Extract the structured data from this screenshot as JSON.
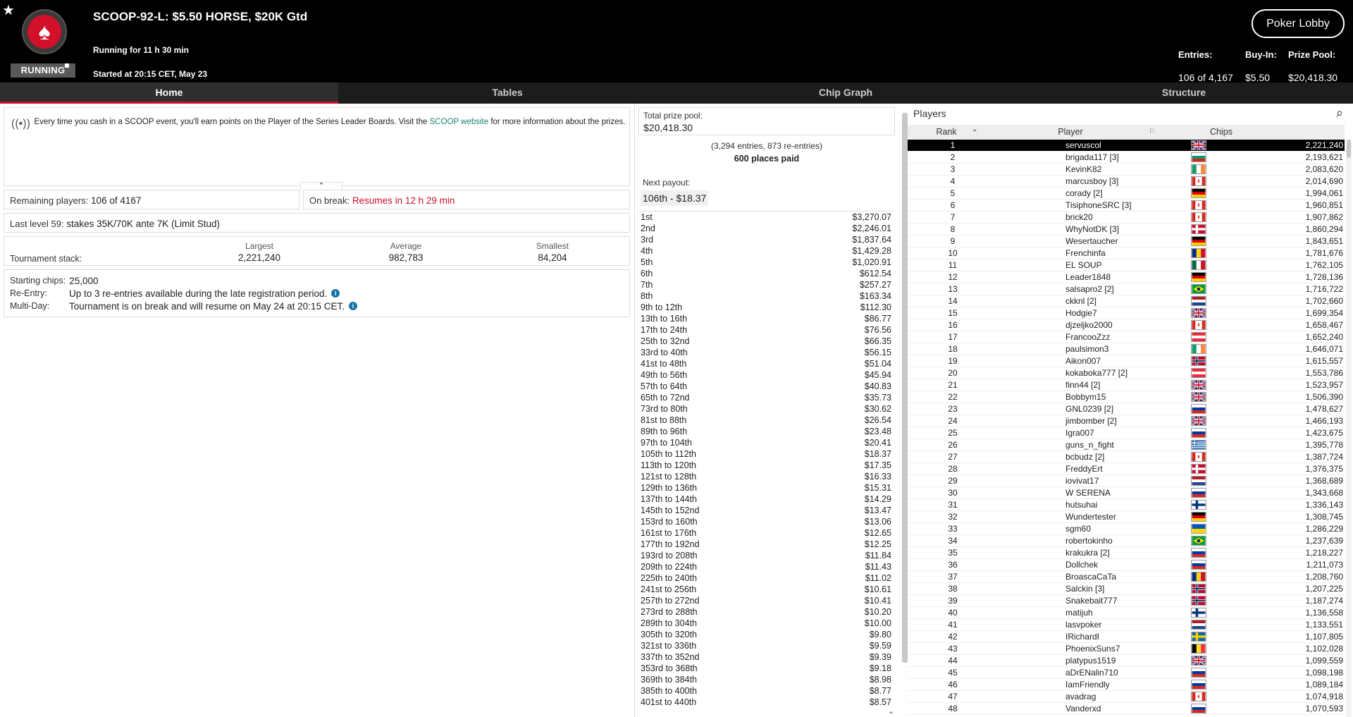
{
  "header": {
    "title": "SCOOP-92-L: $5.50 HORSE, $20K Gtd",
    "status": "RUNNING",
    "running_for": "Running for 11 h 30 min",
    "started_at": "Started at 20:15 CET, May 23",
    "lobby_button": "Poker Lobby",
    "entries_label": "Entries:",
    "entries_value": "106 of 4,167",
    "buyin_label": "Buy-In:",
    "buyin_value": "$5.50",
    "prize_label": "Prize Pool:",
    "prize_value": "$20,418.30"
  },
  "tabs": [
    {
      "label": "Home",
      "active": true
    },
    {
      "label": "Tables",
      "active": false
    },
    {
      "label": "Chip Graph",
      "active": false
    },
    {
      "label": "Structure",
      "active": false
    }
  ],
  "home": {
    "info_pre": "Every time you cash in a SCOOP event, you'll earn points on the Player of the Series Leader Boards. Visit the ",
    "info_link": "SCOOP website",
    "info_post": " for more information about the prizes.",
    "remaining_label": "Remaining players:",
    "remaining_value": "106 of 4167",
    "onbreak_label": "On break:",
    "onbreak_value": "Resumes in 12 h 29 min",
    "lastlevel_label": "Last level 59:",
    "lastlevel_value": "stakes 35K/70K ante 7K (Limit Stud)",
    "stack_label": "Tournament stack:",
    "largest_label": "Largest",
    "largest_value": "2,221,240",
    "average_label": "Average",
    "average_value": "982,783",
    "smallest_label": "Smallest",
    "smallest_value": "84,204",
    "starting_label": "Starting chips:",
    "starting_value": "25,000",
    "reentry_label": "Re-Entry:",
    "reentry_value": "Up to 3 re-entries available during the late registration period.",
    "multiday_label": "Multi-Day:",
    "multiday_value": "Tournament is on break and will resume on May 24 at 20:15 CET."
  },
  "prizes": {
    "pool_label": "Total prize pool:",
    "pool_value": "$20,418.30",
    "entries_text": "(3,294 entries, 873 re-entries)",
    "places_paid": "600 places paid",
    "next_label": "Next payout:",
    "next_value": "106th - $18.37",
    "rows": [
      [
        "1st",
        "$3,270.07"
      ],
      [
        "2nd",
        "$2,246.01"
      ],
      [
        "3rd",
        "$1,837.64"
      ],
      [
        "4th",
        "$1,429.28"
      ],
      [
        "5th",
        "$1,020.91"
      ],
      [
        "6th",
        "$612.54"
      ],
      [
        "7th",
        "$257.27"
      ],
      [
        "8th",
        "$163.34"
      ],
      [
        "9th to 12th",
        "$112.30"
      ],
      [
        "13th to 16th",
        "$86.77"
      ],
      [
        "17th to 24th",
        "$76.56"
      ],
      [
        "25th to 32nd",
        "$66.35"
      ],
      [
        "33rd to 40th",
        "$56.15"
      ],
      [
        "41st to 48th",
        "$51.04"
      ],
      [
        "49th to 56th",
        "$45.94"
      ],
      [
        "57th to 64th",
        "$40.83"
      ],
      [
        "65th to 72nd",
        "$35.73"
      ],
      [
        "73rd to 80th",
        "$30.62"
      ],
      [
        "81st to 88th",
        "$26.54"
      ],
      [
        "89th to 96th",
        "$23.48"
      ],
      [
        "97th to 104th",
        "$20.41"
      ],
      [
        "105th to 112th",
        "$18.37"
      ],
      [
        "113th to 120th",
        "$17.35"
      ],
      [
        "121st to 128th",
        "$16.33"
      ],
      [
        "129th to 136th",
        "$15.31"
      ],
      [
        "137th to 144th",
        "$14.29"
      ],
      [
        "145th to 152nd",
        "$13.47"
      ],
      [
        "153rd to 160th",
        "$13.06"
      ],
      [
        "161st to 176th",
        "$12.65"
      ],
      [
        "177th to 192nd",
        "$12.25"
      ],
      [
        "193rd to 208th",
        "$11.84"
      ],
      [
        "209th to 224th",
        "$11.43"
      ],
      [
        "225th to 240th",
        "$11.02"
      ],
      [
        "241st to 256th",
        "$10.61"
      ],
      [
        "257th to 272nd",
        "$10.41"
      ],
      [
        "273rd to 288th",
        "$10.20"
      ],
      [
        "289th to 304th",
        "$10.00"
      ],
      [
        "305th to 320th",
        "$9.80"
      ],
      [
        "321st to 336th",
        "$9.59"
      ],
      [
        "337th to 352nd",
        "$9.39"
      ],
      [
        "353rd to 368th",
        "$9.18"
      ],
      [
        "369th to 384th",
        "$8.98"
      ],
      [
        "385th to 400th",
        "$8.77"
      ],
      [
        "401st to 440th",
        "$8.57"
      ]
    ]
  },
  "players": {
    "title": "Players",
    "col_rank": "Rank",
    "col_player": "Player",
    "col_chips": "Chips",
    "rows": [
      [
        1,
        "servuscol",
        "gb",
        "2,221,240"
      ],
      [
        2,
        "brigada117 [3]",
        "bg",
        "2,193,621"
      ],
      [
        3,
        "KevinK82",
        "ie",
        "2,083,620"
      ],
      [
        4,
        "marcusboy [3]",
        "ca",
        "2,014,690"
      ],
      [
        5,
        "corady [2]",
        "de",
        "1,994,061"
      ],
      [
        6,
        "TisiphoneSRC [3]",
        "ca",
        "1,960,851"
      ],
      [
        7,
        "brick20",
        "ca",
        "1,907,862"
      ],
      [
        8,
        "WhyNotDK [3]",
        "dk",
        "1,860,294"
      ],
      [
        9,
        "Wesertaucher",
        "de",
        "1,843,651"
      ],
      [
        10,
        "Frenchinfa",
        "ro",
        "1,781,676"
      ],
      [
        11,
        "EL SOUP",
        "mx",
        "1,762,105"
      ],
      [
        12,
        "Leader1848",
        "de",
        "1,728,136"
      ],
      [
        13,
        "salsapro2 [2]",
        "br",
        "1,716,722"
      ],
      [
        14,
        "ckknl [2]",
        "nl",
        "1,702,660"
      ],
      [
        15,
        "Hodgie7",
        "gb",
        "1,699,354"
      ],
      [
        16,
        "djzeljko2000",
        "ca",
        "1,658,467"
      ],
      [
        17,
        "FrancooZzz",
        "at",
        "1,652,240"
      ],
      [
        18,
        "paulsimon3",
        "ie",
        "1,646,071"
      ],
      [
        19,
        "Aikon007",
        "no",
        "1,615,557"
      ],
      [
        20,
        "kokaboka777 [2]",
        "at",
        "1,553,786"
      ],
      [
        21,
        "finn44 [2]",
        "gb",
        "1,523,957"
      ],
      [
        22,
        "Bobbym15",
        "gb",
        "1,506,390"
      ],
      [
        23,
        "GNL0239 [2]",
        "ru",
        "1,478,627"
      ],
      [
        24,
        "jimbomber [2]",
        "gb",
        "1,466,193"
      ],
      [
        25,
        "Igra007",
        "ru",
        "1,423,675"
      ],
      [
        26,
        "guns_n_fight",
        "gr",
        "1,395,778"
      ],
      [
        27,
        "bcbudz [2]",
        "ca",
        "1,387,724"
      ],
      [
        28,
        "FreddyErt",
        "dk",
        "1,376,375"
      ],
      [
        29,
        "iovivat17",
        "nl",
        "1,368,689"
      ],
      [
        30,
        "W SERENA",
        "ru",
        "1,343,668"
      ],
      [
        31,
        "hutsuhai",
        "fi",
        "1,336,143"
      ],
      [
        32,
        "Wundertester",
        "de",
        "1,308,745"
      ],
      [
        33,
        "sgm60",
        "ua",
        "1,286,229"
      ],
      [
        34,
        "robertokinho",
        "br",
        "1,237,639"
      ],
      [
        35,
        "krakukra [2]",
        "ru",
        "1,218,227"
      ],
      [
        36,
        "Dollchek",
        "ru",
        "1,211,073"
      ],
      [
        37,
        "BroascaCaTa",
        "ro",
        "1,208,760"
      ],
      [
        38,
        "Salckin [3]",
        "no",
        "1,207,225"
      ],
      [
        39,
        "Snakebait777",
        "no",
        "1,187,274"
      ],
      [
        40,
        "matijuh",
        "fi",
        "1,136,558"
      ],
      [
        41,
        "lasvpoker",
        "nl",
        "1,133,551"
      ],
      [
        42,
        "IRichardI",
        "se",
        "1,107,805"
      ],
      [
        43,
        "PhoenixSuns7",
        "be",
        "1,102,028"
      ],
      [
        44,
        "platypus1519",
        "gb",
        "1,099,559"
      ],
      [
        45,
        "aDrENalin710",
        "ru",
        "1,098,198"
      ],
      [
        46,
        "IamFriendly",
        "ru",
        "1,089,184"
      ],
      [
        47,
        "avadrag",
        "ca",
        "1,074,918"
      ],
      [
        48,
        "Vanderxd",
        "ru",
        "1,070,593"
      ]
    ]
  }
}
